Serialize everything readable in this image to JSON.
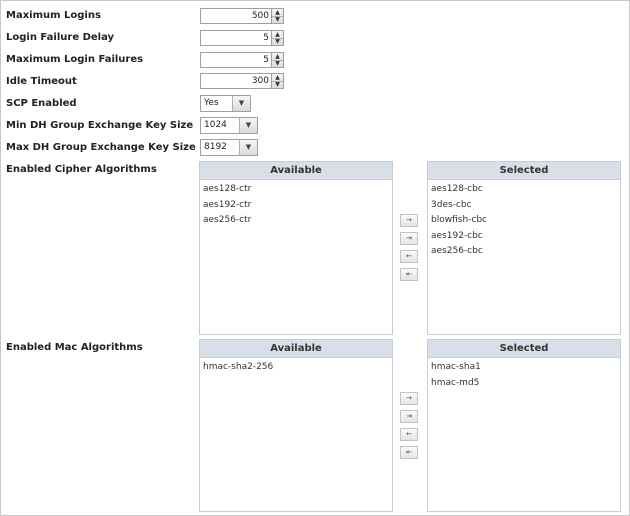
{
  "fields": {
    "max_logins": {
      "label": "Maximum Logins",
      "value": "500"
    },
    "login_failure_delay": {
      "label": "Login Failure Delay",
      "value": "5"
    },
    "max_login_failures": {
      "label": "Maximum Login Failures",
      "value": "5"
    },
    "idle_timeout": {
      "label": "Idle Timeout",
      "value": "300"
    },
    "scp_enabled": {
      "label": "SCP Enabled",
      "value": "Yes"
    },
    "min_dh": {
      "label": "Min DH Group Exchange Key Size",
      "value": "1024"
    },
    "max_dh": {
      "label": "Max DH Group Exchange Key Size",
      "value": "8192"
    }
  },
  "cipher": {
    "label": "Enabled Cipher Algorithms",
    "available_header": "Available",
    "selected_header": "Selected",
    "available": [
      "aes128-ctr",
      "aes192-ctr",
      "aes256-ctr"
    ],
    "selected": [
      "aes128-cbc",
      "3des-cbc",
      "blowfish-cbc",
      "aes192-cbc",
      "aes256-cbc"
    ]
  },
  "mac": {
    "label": "Enabled Mac Algorithms",
    "available_header": "Available",
    "selected_header": "Selected",
    "available": [
      "hmac-sha2-256"
    ],
    "selected": [
      "hmac-sha1",
      "hmac-md5"
    ]
  },
  "icons": {
    "spinner_up": "▲",
    "spinner_down": "▼",
    "dropdown": "▼",
    "move_right": "→",
    "move_all_right": "⇥",
    "move_left": "←",
    "move_all_left": "⇤"
  }
}
